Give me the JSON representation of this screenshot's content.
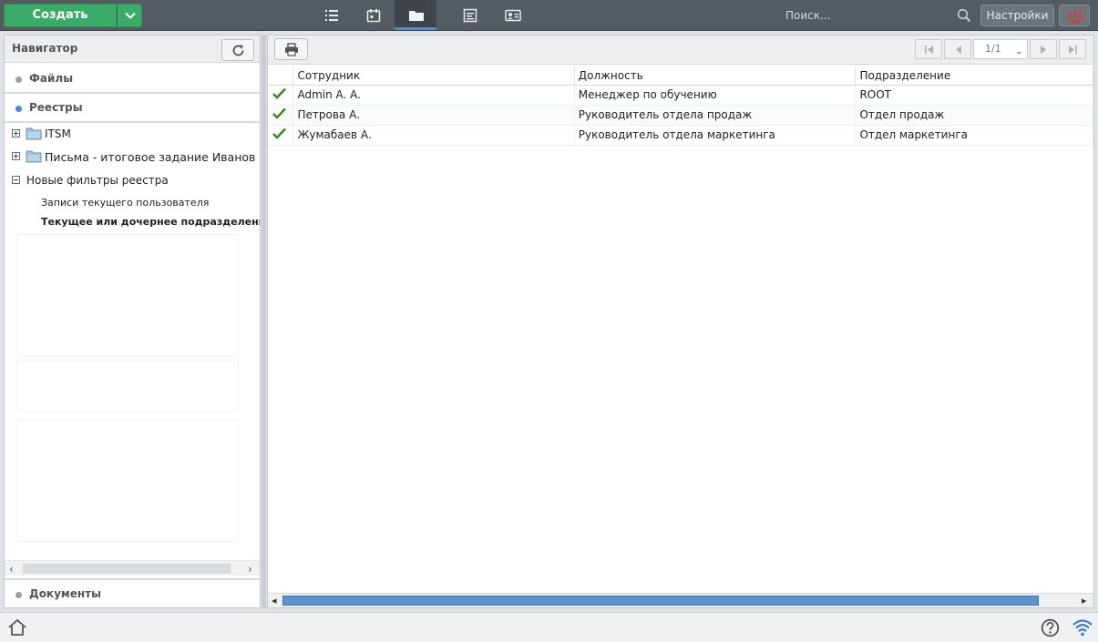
{
  "topbar": {
    "create_label": "Создать",
    "tabs": [
      {
        "icon": "list-icon"
      },
      {
        "icon": "calendar-icon"
      },
      {
        "icon": "folder-icon",
        "active": true
      },
      {
        "icon": "document-icon"
      },
      {
        "icon": "contact-card-icon"
      }
    ],
    "search_placeholder": "Поиск...",
    "settings_label": "Настройки",
    "accent": "#3cab6a",
    "power_color": "#e0372c"
  },
  "navigator": {
    "title": "Навигатор",
    "sections": {
      "files": "Файлы",
      "registries": "Реестры",
      "documents": "Документы"
    },
    "tree": {
      "itsm": "ITSM",
      "letters": "Письма - итоговое задание Иванов",
      "new_filters": "Новые фильтры реестра",
      "filter_current_user": "Записи текущего пользователя",
      "filter_current_dept": "Текущее или дочернее подразделение"
    }
  },
  "pager": {
    "current": "1/1"
  },
  "grid": {
    "columns": {
      "employee": "Сотрудник",
      "position": "Должность",
      "department": "Подразделение"
    },
    "rows": [
      {
        "employee": "Admin A. A.",
        "position": "Менеджер по обучению",
        "department": "ROOT"
      },
      {
        "employee": "Петрова А.",
        "position": "Руководитель отдела продаж",
        "department": "Отдел продаж"
      },
      {
        "employee": "Жумабаев А.",
        "position": "Руководитель отдела маркетинга",
        "department": "Отдел маркетинга"
      }
    ]
  }
}
